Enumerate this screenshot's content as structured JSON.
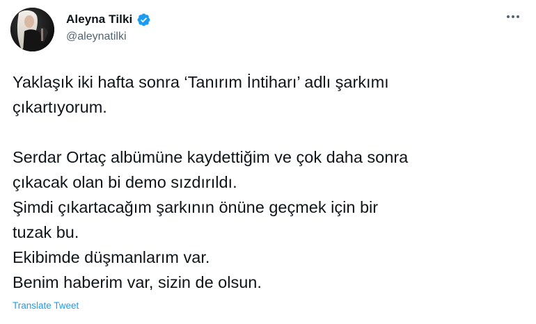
{
  "author": {
    "display_name": "Aleyna Tilki",
    "handle": "@aleynatilki",
    "verified": true,
    "verified_icon": "verified-badge-icon",
    "verified_color": "#1d9bf0"
  },
  "more_icon": "more-horizontal-icon",
  "tweet": {
    "paragraph_1": [
      "Yaklaşık iki hafta sonra ‘Tanırım İntiharı’ adlı şarkımı",
      "çıkartıyorum."
    ],
    "paragraph_2": [
      "Serdar Ortaç albümüne kaydettiğim ve çok daha sonra",
      "çıkacak olan bi demo sızdırıldı.",
      "Şimdi çıkartacağım şarkının önüne geçmek için bir",
      "tuzak bu.",
      "Ekibimde düşmanlarım var.",
      "Benim haberim var, sizin de olsun."
    ]
  },
  "translate_label": "Translate Tweet",
  "colors": {
    "text": "#0f1419",
    "secondary": "#536471",
    "link": "#1d9bf0"
  }
}
